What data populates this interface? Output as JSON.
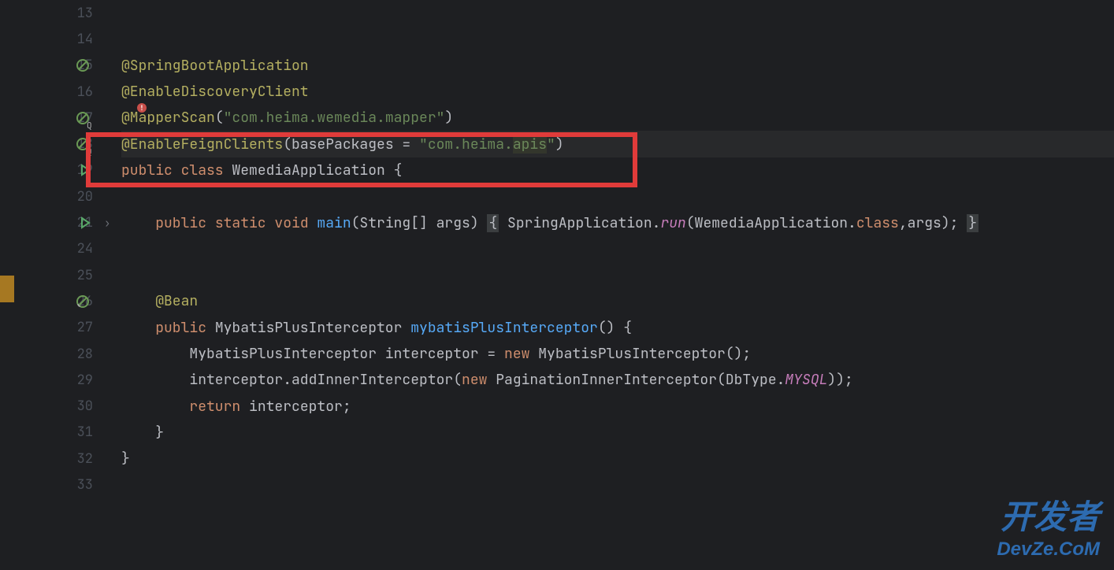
{
  "lines": {
    "13": "13",
    "14": "14",
    "15": "15",
    "16": "16",
    "17": "17",
    "18": "18",
    "19": "19",
    "20": "20",
    "21": "21",
    "24": "24",
    "25": "25",
    "26": "26",
    "27": "27",
    "28": "28",
    "29": "29",
    "30": "30",
    "31": "31",
    "32": "32",
    "33": "33"
  },
  "code": {
    "l15": {
      "annot": "@SpringBootApplication"
    },
    "l16": {
      "annot": "@EnableDiscoveryClient"
    },
    "l17": {
      "annot1": "@MapperScan",
      "p1": "(",
      "s": "\"com.heima.wemedia.mapper\"",
      "p2": ")"
    },
    "l18": {
      "annot": "@EnableFeignClients",
      "p1": "(",
      "param": "basePackages = ",
      "s1": "\"com.heima.",
      "hl": "apis",
      "s2": "\"",
      "p2": ")"
    },
    "l19": {
      "kw1": "public ",
      "kw2": "class ",
      "name": "WemediaApplication ",
      "brace": "{"
    },
    "l21": {
      "ind": "    ",
      "kw1": "public ",
      "kw2": "static ",
      "kw3": "void ",
      "fn": "main",
      "p1": "(String[] args) ",
      "b1": "{",
      "mid": " SpringApplication.",
      "run": "run",
      "p2": "(WemediaApplication.",
      "kw4": "class",
      "p3": ",args); ",
      "b2": "}"
    },
    "l26": {
      "ind": "    ",
      "annot": "@Bean"
    },
    "l27": {
      "ind": "    ",
      "kw": "public ",
      "type": "MybatisPlusInterceptor ",
      "fn": "mybatisPlusInterceptor",
      "rest": "() {"
    },
    "l28": {
      "ind": "        ",
      "type": "MybatisPlusInterceptor interceptor = ",
      "kw": "new ",
      "rest": "MybatisPlusInterceptor();"
    },
    "l29": {
      "ind": "        ",
      "txt1": "interceptor.addInnerInterceptor(",
      "kw": "new ",
      "txt2": "PaginationInnerInterceptor(DbType.",
      "field": "MYSQL",
      "txt3": "));"
    },
    "l30": {
      "ind": "        ",
      "kw": "return ",
      "rest": "interceptor;"
    },
    "l31": {
      "ind": "    ",
      "brace": "}"
    },
    "l32": {
      "brace": "}"
    }
  },
  "watermark": {
    "line1": "开发者",
    "line2": "DevZe.CoM"
  },
  "colors": {
    "bg": "#1e1f22",
    "red": "#e03b3a",
    "blue": "#2d6bb0"
  }
}
